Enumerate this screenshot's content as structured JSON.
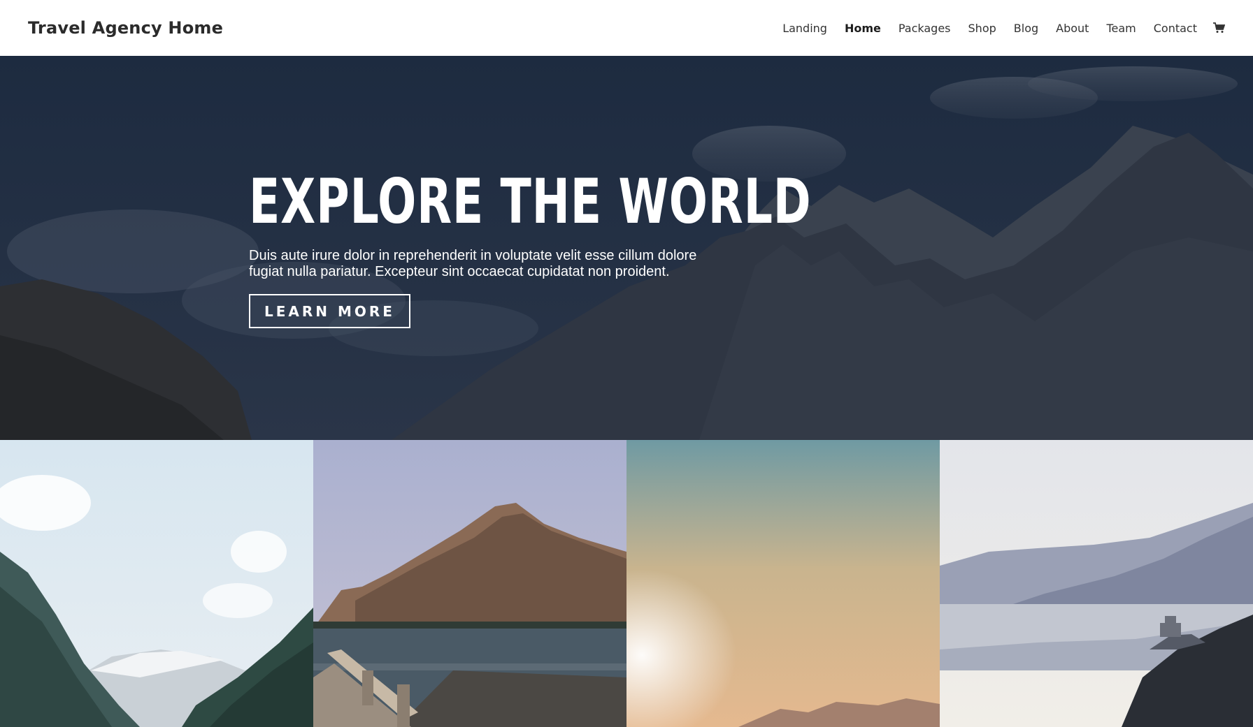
{
  "header": {
    "site_title": "Travel Agency Home",
    "nav": [
      {
        "label": "Landing",
        "active": false
      },
      {
        "label": "Home",
        "active": true
      },
      {
        "label": "Packages",
        "active": false
      },
      {
        "label": "Shop",
        "active": false
      },
      {
        "label": "Blog",
        "active": false
      },
      {
        "label": "About",
        "active": false
      },
      {
        "label": "Team",
        "active": false
      },
      {
        "label": "Contact",
        "active": false
      }
    ],
    "cart_icon": "shopping-cart-icon"
  },
  "hero": {
    "title": "EXPLORE THE WORLD",
    "text": "Duis aute irure dolor in reprehenderit in voluptate velit esse cillum dolore fugiat nulla pariatur. Excepteur sint occaecat cupidatat non proident.",
    "button_label": "LEARN MORE",
    "background": "mountain-landscape-image"
  },
  "gallery": [
    {
      "image": "glacier-valley-lake-image"
    },
    {
      "image": "mountain-lake-dock-image"
    },
    {
      "image": "sunset-haze-mountains-image"
    },
    {
      "image": "river-gorge-vista-image"
    }
  ],
  "colors": {
    "hero_overlay": "#1f2d42",
    "header_bg": "#ffffff",
    "text_light": "#ffffff",
    "text_dark": "#2b2b2b"
  }
}
